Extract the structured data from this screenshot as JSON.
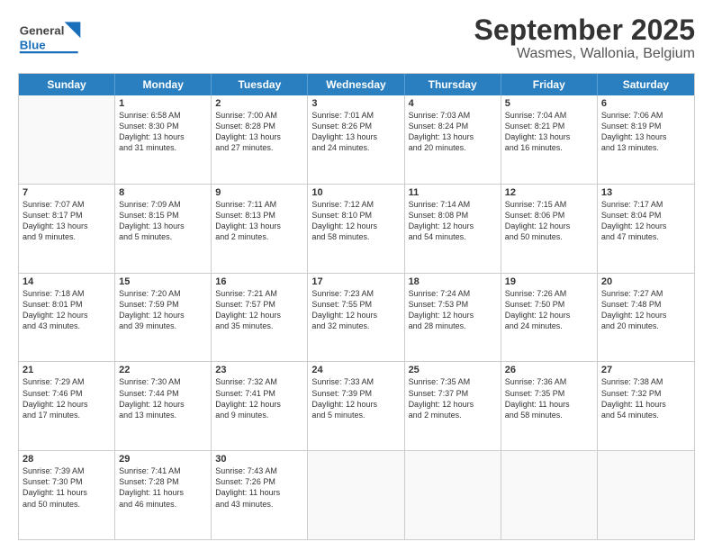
{
  "header": {
    "logo_general": "General",
    "logo_blue": "Blue",
    "month_title": "September 2025",
    "location": "Wasmes, Wallonia, Belgium"
  },
  "weekdays": [
    "Sunday",
    "Monday",
    "Tuesday",
    "Wednesday",
    "Thursday",
    "Friday",
    "Saturday"
  ],
  "rows": [
    [
      {
        "day": "",
        "info": ""
      },
      {
        "day": "1",
        "info": "Sunrise: 6:58 AM\nSunset: 8:30 PM\nDaylight: 13 hours\nand 31 minutes."
      },
      {
        "day": "2",
        "info": "Sunrise: 7:00 AM\nSunset: 8:28 PM\nDaylight: 13 hours\nand 27 minutes."
      },
      {
        "day": "3",
        "info": "Sunrise: 7:01 AM\nSunset: 8:26 PM\nDaylight: 13 hours\nand 24 minutes."
      },
      {
        "day": "4",
        "info": "Sunrise: 7:03 AM\nSunset: 8:24 PM\nDaylight: 13 hours\nand 20 minutes."
      },
      {
        "day": "5",
        "info": "Sunrise: 7:04 AM\nSunset: 8:21 PM\nDaylight: 13 hours\nand 16 minutes."
      },
      {
        "day": "6",
        "info": "Sunrise: 7:06 AM\nSunset: 8:19 PM\nDaylight: 13 hours\nand 13 minutes."
      }
    ],
    [
      {
        "day": "7",
        "info": "Sunrise: 7:07 AM\nSunset: 8:17 PM\nDaylight: 13 hours\nand 9 minutes."
      },
      {
        "day": "8",
        "info": "Sunrise: 7:09 AM\nSunset: 8:15 PM\nDaylight: 13 hours\nand 5 minutes."
      },
      {
        "day": "9",
        "info": "Sunrise: 7:11 AM\nSunset: 8:13 PM\nDaylight: 13 hours\nand 2 minutes."
      },
      {
        "day": "10",
        "info": "Sunrise: 7:12 AM\nSunset: 8:10 PM\nDaylight: 12 hours\nand 58 minutes."
      },
      {
        "day": "11",
        "info": "Sunrise: 7:14 AM\nSunset: 8:08 PM\nDaylight: 12 hours\nand 54 minutes."
      },
      {
        "day": "12",
        "info": "Sunrise: 7:15 AM\nSunset: 8:06 PM\nDaylight: 12 hours\nand 50 minutes."
      },
      {
        "day": "13",
        "info": "Sunrise: 7:17 AM\nSunset: 8:04 PM\nDaylight: 12 hours\nand 47 minutes."
      }
    ],
    [
      {
        "day": "14",
        "info": "Sunrise: 7:18 AM\nSunset: 8:01 PM\nDaylight: 12 hours\nand 43 minutes."
      },
      {
        "day": "15",
        "info": "Sunrise: 7:20 AM\nSunset: 7:59 PM\nDaylight: 12 hours\nand 39 minutes."
      },
      {
        "day": "16",
        "info": "Sunrise: 7:21 AM\nSunset: 7:57 PM\nDaylight: 12 hours\nand 35 minutes."
      },
      {
        "day": "17",
        "info": "Sunrise: 7:23 AM\nSunset: 7:55 PM\nDaylight: 12 hours\nand 32 minutes."
      },
      {
        "day": "18",
        "info": "Sunrise: 7:24 AM\nSunset: 7:53 PM\nDaylight: 12 hours\nand 28 minutes."
      },
      {
        "day": "19",
        "info": "Sunrise: 7:26 AM\nSunset: 7:50 PM\nDaylight: 12 hours\nand 24 minutes."
      },
      {
        "day": "20",
        "info": "Sunrise: 7:27 AM\nSunset: 7:48 PM\nDaylight: 12 hours\nand 20 minutes."
      }
    ],
    [
      {
        "day": "21",
        "info": "Sunrise: 7:29 AM\nSunset: 7:46 PM\nDaylight: 12 hours\nand 17 minutes."
      },
      {
        "day": "22",
        "info": "Sunrise: 7:30 AM\nSunset: 7:44 PM\nDaylight: 12 hours\nand 13 minutes."
      },
      {
        "day": "23",
        "info": "Sunrise: 7:32 AM\nSunset: 7:41 PM\nDaylight: 12 hours\nand 9 minutes."
      },
      {
        "day": "24",
        "info": "Sunrise: 7:33 AM\nSunset: 7:39 PM\nDaylight: 12 hours\nand 5 minutes."
      },
      {
        "day": "25",
        "info": "Sunrise: 7:35 AM\nSunset: 7:37 PM\nDaylight: 12 hours\nand 2 minutes."
      },
      {
        "day": "26",
        "info": "Sunrise: 7:36 AM\nSunset: 7:35 PM\nDaylight: 11 hours\nand 58 minutes."
      },
      {
        "day": "27",
        "info": "Sunrise: 7:38 AM\nSunset: 7:32 PM\nDaylight: 11 hours\nand 54 minutes."
      }
    ],
    [
      {
        "day": "28",
        "info": "Sunrise: 7:39 AM\nSunset: 7:30 PM\nDaylight: 11 hours\nand 50 minutes."
      },
      {
        "day": "29",
        "info": "Sunrise: 7:41 AM\nSunset: 7:28 PM\nDaylight: 11 hours\nand 46 minutes."
      },
      {
        "day": "30",
        "info": "Sunrise: 7:43 AM\nSunset: 7:26 PM\nDaylight: 11 hours\nand 43 minutes."
      },
      {
        "day": "",
        "info": ""
      },
      {
        "day": "",
        "info": ""
      },
      {
        "day": "",
        "info": ""
      },
      {
        "day": "",
        "info": ""
      }
    ]
  ]
}
